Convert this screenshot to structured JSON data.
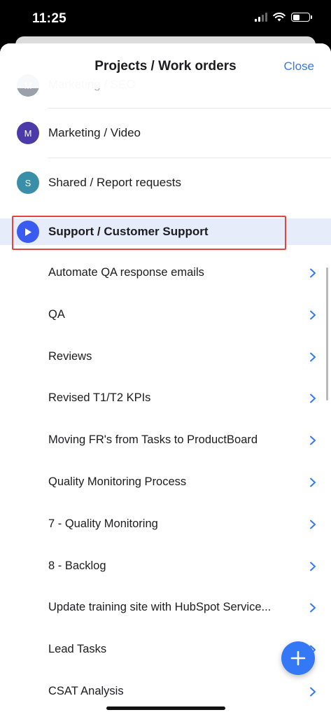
{
  "status_bar": {
    "time": "11:25"
  },
  "header": {
    "title": "Projects / Work orders",
    "close_label": "Close"
  },
  "projects": [
    {
      "initial": "M",
      "label": "Marketing / SEO",
      "color": "#4a5568"
    },
    {
      "initial": "M",
      "label": "Marketing / Video",
      "color": "#4b3aa8"
    },
    {
      "initial": "S",
      "label": "Shared / Report requests",
      "color": "#3a8fa8"
    }
  ],
  "selected_project": {
    "label": "Support / Customer Support",
    "icon": "play-icon",
    "color": "#3a5bf0"
  },
  "tasks": [
    "Automate QA response emails",
    "QA",
    "Reviews",
    "Revised T1/T2 KPIs",
    "Moving FR's from Tasks to ProductBoard",
    "Quality Monitoring Process",
    "7 - Quality Monitoring",
    "8 - Backlog",
    "Update training site with HubSpot Service...",
    "Lead Tasks",
    "CSAT Analysis"
  ],
  "fab": {
    "icon": "plus-icon",
    "color": "#3478f6"
  },
  "accent_color": "#3478f6",
  "highlight_color": "#e0453f"
}
